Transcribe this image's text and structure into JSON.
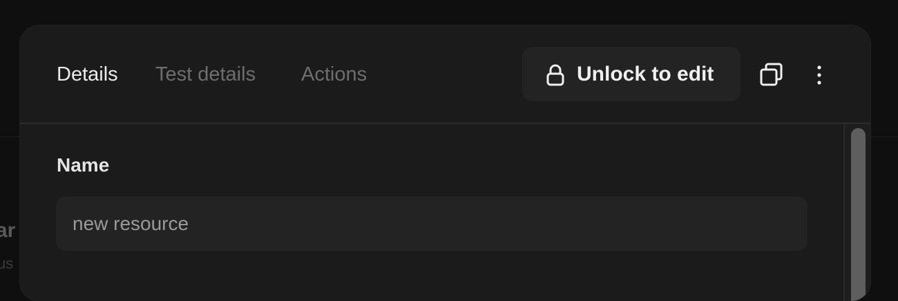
{
  "background": {
    "partial_text_1": "ar",
    "partial_text_2": "us"
  },
  "tabs": [
    {
      "label": "Details",
      "active": true
    },
    {
      "label": "Test details",
      "active": false
    },
    {
      "label": "Actions",
      "active": false
    }
  ],
  "toolbar": {
    "unlock_label": "Unlock to edit",
    "unlock_icon": "lock-icon",
    "copy_icon": "copy-icon",
    "more_icon": "more-vertical-icon"
  },
  "form": {
    "name_label": "Name",
    "name_value": "new resource",
    "name_placeholder": ""
  },
  "colors": {
    "page_bg": "#0f0f0f",
    "panel_bg": "#1b1b1b",
    "input_bg": "#232323",
    "active_tab": "#ececec",
    "inactive_tab": "#6e6e6e"
  }
}
